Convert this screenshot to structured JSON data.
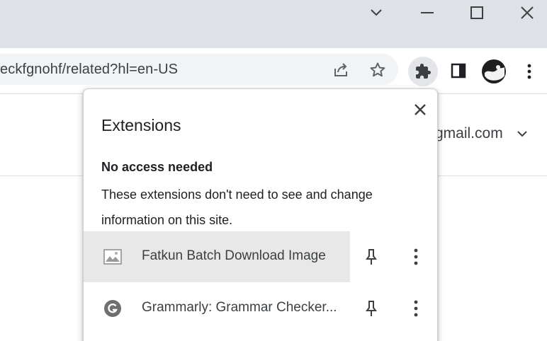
{
  "window_controls": {
    "tab_search_icon": "chevron-down-icon",
    "minimize_icon": "minimize-icon",
    "maximize_icon": "maximize-icon",
    "close_icon": "close-icon"
  },
  "toolbar": {
    "url": "eckfgnohf/related?hl=en-US",
    "icons": [
      "share-icon",
      "bookmark-star-icon",
      "extensions-puzzle-icon",
      "side-panel-icon",
      "profile-avatar-icon",
      "more-vert-icon"
    ]
  },
  "page": {
    "account_email": "gmail.com"
  },
  "extensions_popup": {
    "title": "Extensions",
    "section_heading": "No access needed",
    "section_description": "These extensions don't need to see and change information on this site.",
    "items": [
      {
        "name": "Fatkun Batch Download Image",
        "icon": "image-icon",
        "highlighted": true
      },
      {
        "name": "Grammarly: Grammar Checker...",
        "icon": "grammarly-icon",
        "highlighted": false
      }
    ]
  },
  "colors": {
    "titlebar": "#dee1e6",
    "omnibox": "#f1f3f4",
    "row_highlight": "#e8e8e8",
    "icon_dark": "#3c4043"
  }
}
